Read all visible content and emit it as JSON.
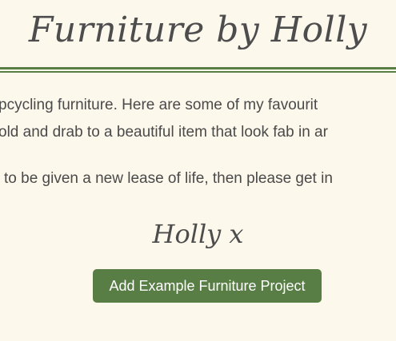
{
  "header": {
    "title": "Furniture by Holly"
  },
  "intro": {
    "line1": "pcycling furniture. Here are some of my favourit",
    "line2": "old and drab to a beautiful item that look fab in ar",
    "line3": "to be given a new lease of life, then please get in"
  },
  "signature": "Holly x",
  "actions": {
    "add_project_label": "Add Example Furniture Project"
  },
  "colors": {
    "background": "#fdf8ec",
    "accent": "#587d45",
    "text": "#4a4a4a"
  }
}
